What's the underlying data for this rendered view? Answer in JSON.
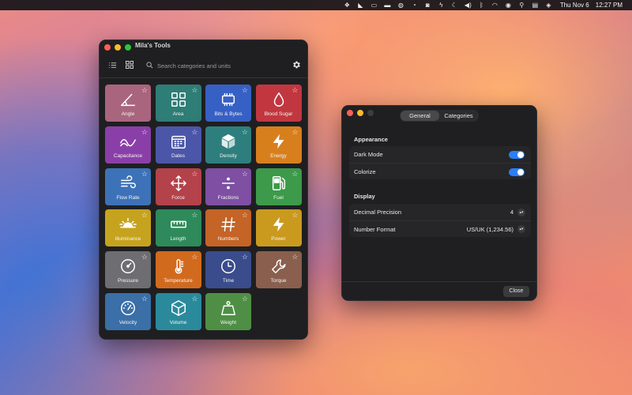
{
  "menubar": {
    "icons": [
      "dropbox-icon",
      "chart-icon",
      "screen-icon",
      "display-icon",
      "sync-icon",
      "timer-icon",
      "o-icon",
      "bolt-icon",
      "moon-icon",
      "volume-icon",
      "bluetooth-icon",
      "wifi-icon",
      "user-icon",
      "search-icon",
      "controls-icon",
      "siri-icon"
    ],
    "date": "Thu Nov 6",
    "time": "12:27 PM"
  },
  "main_window": {
    "title": "Mila's Tools",
    "search_placeholder": "Search categories and units",
    "tiles": [
      {
        "label": "Angle",
        "color": "#a9657d",
        "icon": "angle-icon"
      },
      {
        "label": "Area",
        "color": "#2e7d76",
        "icon": "grid-icon"
      },
      {
        "label": "Bits & Bytes",
        "color": "#3760c4",
        "icon": "chip-icon"
      },
      {
        "label": "Blood Sugar",
        "color": "#c2373f",
        "icon": "drop-icon"
      },
      {
        "label": "Capacitance",
        "color": "#8a3fa8",
        "icon": "wave-icon"
      },
      {
        "label": "Dates",
        "color": "#4c56a8",
        "icon": "calendar-icon"
      },
      {
        "label": "Density",
        "color": "#2f7e7e",
        "icon": "cube-icon"
      },
      {
        "label": "Energy",
        "color": "#d87f1d",
        "icon": "bolt-icon"
      },
      {
        "label": "Flow Rate",
        "color": "#3d72b8",
        "icon": "wind-icon"
      },
      {
        "label": "Force",
        "color": "#b4424a",
        "icon": "move-icon"
      },
      {
        "label": "Fractions",
        "color": "#7e4fa2",
        "icon": "divide-icon"
      },
      {
        "label": "Fuel",
        "color": "#3c9a4a",
        "icon": "fuel-icon"
      },
      {
        "label": "Illuminance",
        "color": "#c6a31e",
        "icon": "sun-icon"
      },
      {
        "label": "Length",
        "color": "#2e8a5a",
        "icon": "ruler-icon"
      },
      {
        "label": "Numbers",
        "color": "#c46426",
        "icon": "hash-icon"
      },
      {
        "label": "Power",
        "color": "#c99a1e",
        "icon": "bolt-icon"
      },
      {
        "label": "Pressure",
        "color": "#6e6e72",
        "icon": "gauge-icon"
      },
      {
        "label": "Temperature",
        "color": "#d26a1e",
        "icon": "thermometer-icon"
      },
      {
        "label": "Time",
        "color": "#3a4c8c",
        "icon": "clock-icon"
      },
      {
        "label": "Torque",
        "color": "#8a5f4e",
        "icon": "wrench-icon"
      },
      {
        "label": "Velocity",
        "color": "#3a6fa8",
        "icon": "speedometer-icon"
      },
      {
        "label": "Volume",
        "color": "#2a8a9c",
        "icon": "box-icon"
      },
      {
        "label": "Weight",
        "color": "#4f8f45",
        "icon": "weight-icon"
      }
    ]
  },
  "settings_window": {
    "tabs": [
      {
        "label": "General",
        "active": true
      },
      {
        "label": "Categories",
        "active": false
      }
    ],
    "appearance": {
      "title": "Appearance",
      "dark_mode_label": "Dark Mode",
      "colorize_label": "Colorize"
    },
    "display": {
      "title": "Display",
      "decimal_precision_label": "Decimal Precision",
      "decimal_precision_value": "4",
      "number_format_label": "Number Format",
      "number_format_value": "US/UK (1,234.56)"
    },
    "close_label": "Close"
  }
}
